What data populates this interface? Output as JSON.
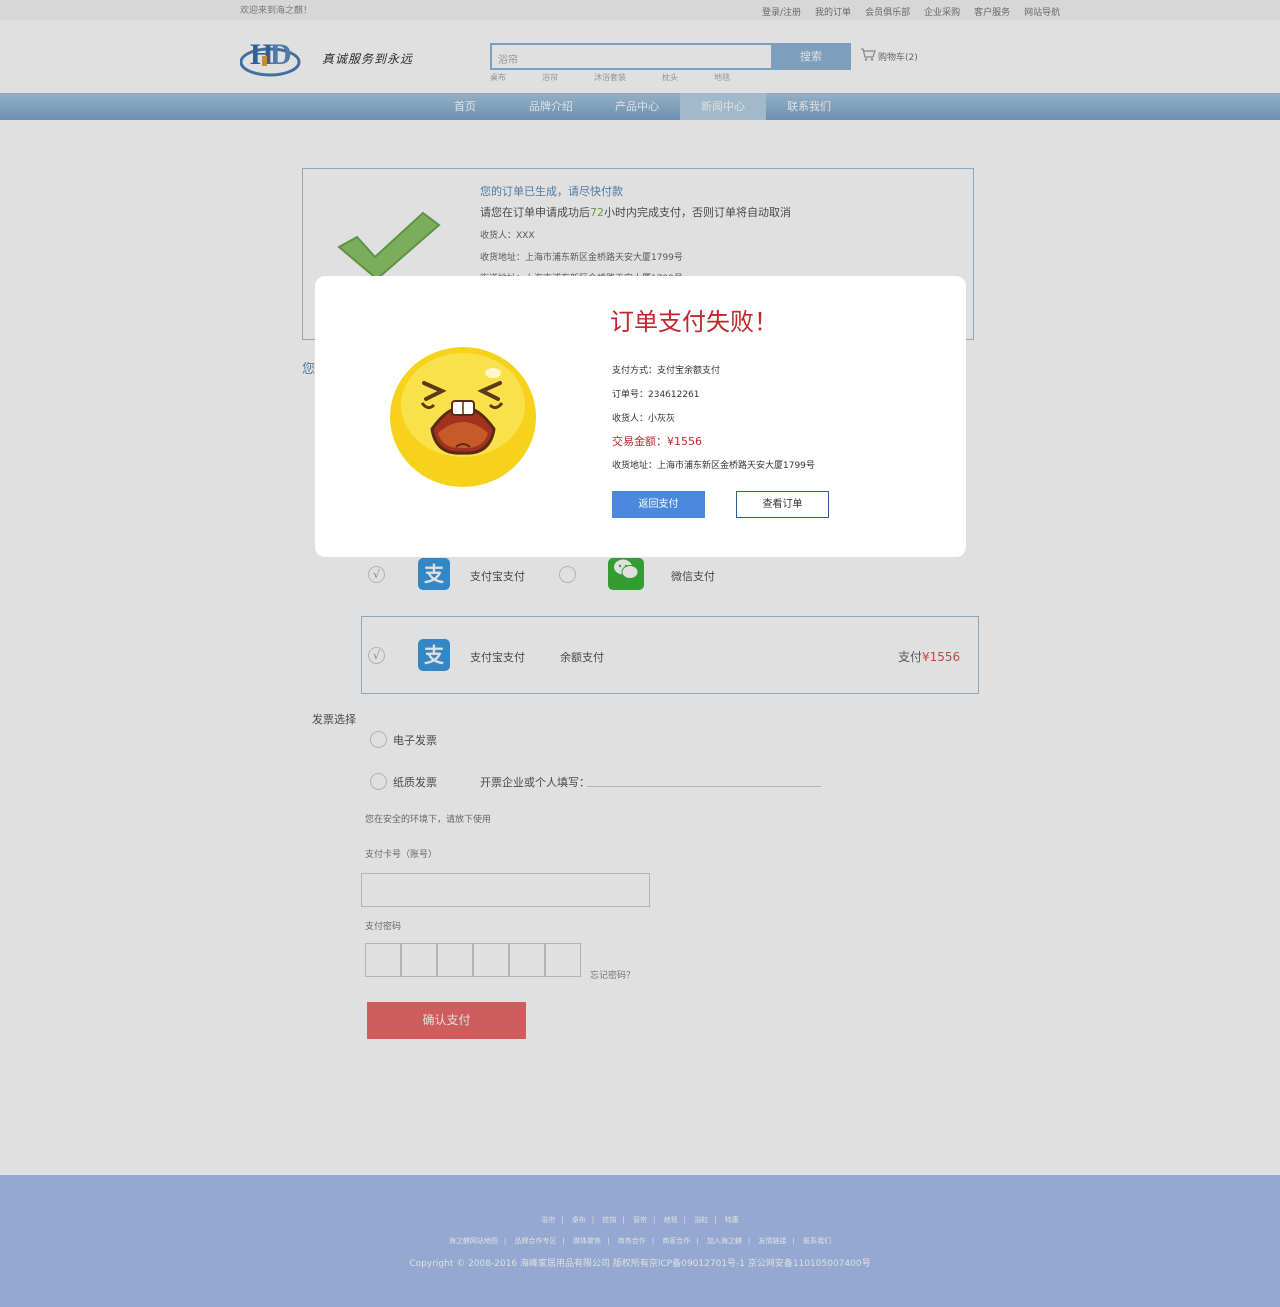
{
  "topbar": {
    "welcome": "欢迎来到海之麒！",
    "links": [
      "登录/注册",
      "我的订单",
      "会员俱乐部",
      "企业采购",
      "客户服务",
      "网站导航"
    ]
  },
  "header": {
    "slogan": "真诚服务到永远",
    "search_placeholder": "浴帘",
    "search_button": "搜索",
    "cart": "购物车(2)",
    "hot_words": [
      "桌布",
      "浴帘",
      "沐浴套装",
      "枕头",
      "地毯"
    ]
  },
  "nav": {
    "items": [
      "首页",
      "品牌介绍",
      "产品中心",
      "新闻中心",
      "联系我们"
    ],
    "active_index": 3
  },
  "order": {
    "title": "您的订单已生成，请尽快付款",
    "notice_prefix": "请您在订单申请成功后",
    "notice_hours": "72",
    "notice_suffix": "小时内完成支付，否则订单将自动取消",
    "receiver": "收货人：XXX",
    "address": "收货地址：上海市浦东新区金桥路天安大厦1799号",
    "street": "街道地址：上海市浦东新区金桥路天安大厦1799号",
    "pay_heading_fragment": "您"
  },
  "payment": {
    "check_mark": "√",
    "alipay_glyph": "支",
    "alipay_label": "支付宝支付",
    "wechat_label": "微信支付",
    "balance_label": "余额支付",
    "amount_prefix": "支付",
    "amount": "¥1556"
  },
  "invoice": {
    "title": "发票选择",
    "electronic": "电子发票",
    "paper": "纸质发票",
    "fill_label": "开票企业或个人填写："
  },
  "security": {
    "safe_text": "您在安全的环境下，请放下使用",
    "card_label": "支付卡号（账号）",
    "password_label": "支付密码",
    "forgot": "忘记密码？",
    "confirm": "确认支付"
  },
  "footer": {
    "links_row1": [
      "浴帘",
      "桌布",
      "挂钩",
      "窗帘",
      "地毯",
      "浴缸",
      "特惠"
    ],
    "links_row2": [
      "海之麒网站地图",
      "品牌合作专区",
      "媒体聚焦",
      "商务合作",
      "商家合作",
      "加入海之麒",
      "友情链接",
      "联系我们"
    ],
    "copyright": "Copyright © 2008-2016 海峰家居用品有限公司  版权所有京ICP备09012701号-1 京公网安备110105007400号"
  },
  "modal": {
    "title": "订单支付失败！",
    "method": "支付方式：支付宝余额支付",
    "order_no": "订单号：234612261",
    "receiver": "收货人：小灰灰",
    "amount": "交易金额：¥1556",
    "address": "收货地址：上海市浦东新区金桥路天安大厦1799号",
    "btn_return": "返回支付",
    "btn_view": "查看订单"
  },
  "colors": {
    "nav_blue": "#8db3d2",
    "failure_red": "#c0272d",
    "return_button": "#4a89dc",
    "confirm_button": "#ec6a6a",
    "footer": "#a9c0ee"
  }
}
